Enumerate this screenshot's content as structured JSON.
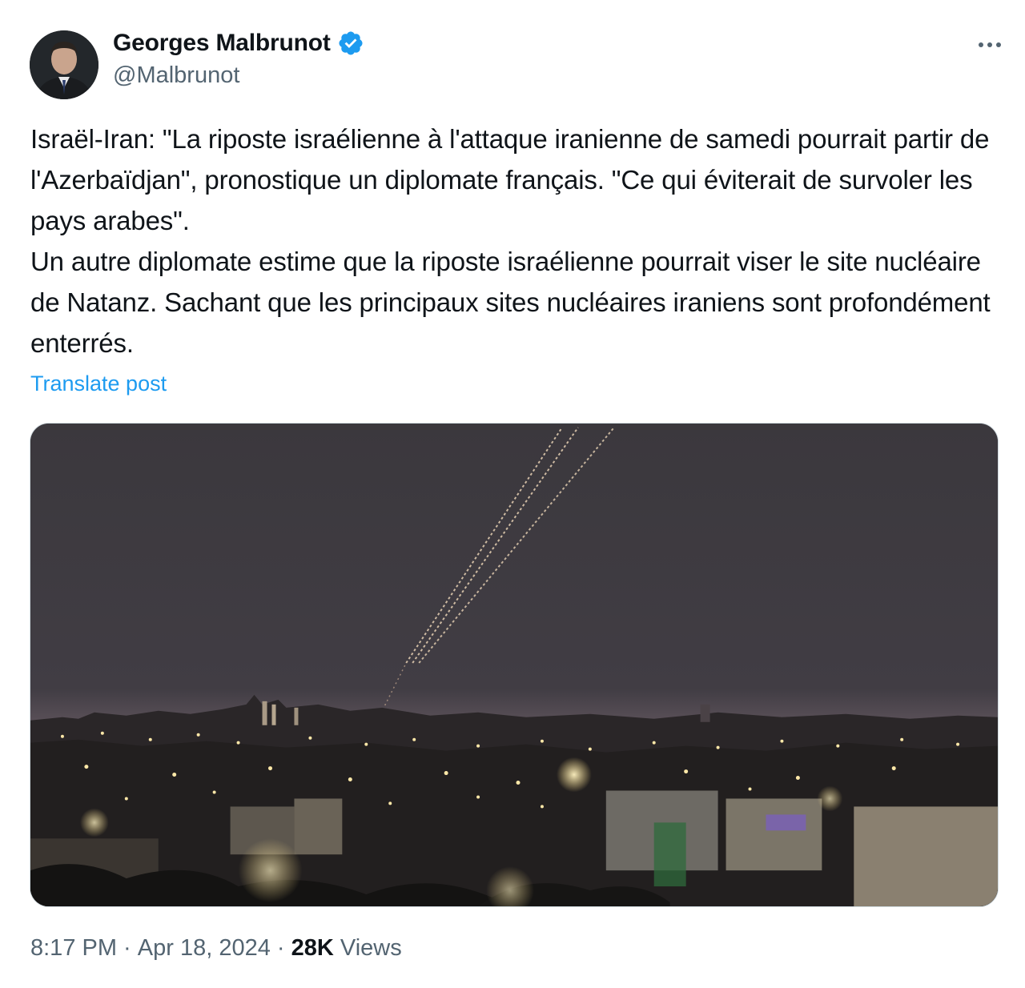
{
  "author": {
    "name": "Georges Malbrunot",
    "handle": "@Malbrunot",
    "verified": true,
    "avatar_icon": "profile-photo"
  },
  "more_icon": "more-horizontal-icon",
  "post": {
    "text": "Israël-Iran: \"La riposte israélienne à l'attaque iranienne de samedi pourrait partir de l'Azerbaïdjan\", pronostique un diplomate français. \"Ce qui éviterait de survoler les pays arabes\".\nUn autre diplomate estime que la riposte israélienne pourrait viser le site nucléaire de Natanz. Sachant que les principaux sites nucléaires iraniens sont profondément enterrés.",
    "translate_label": "Translate post"
  },
  "media": {
    "alt_icon": "night-city-interception-photo"
  },
  "meta": {
    "time": "8:17 PM",
    "separator": " · ",
    "date": "Apr 18, 2024",
    "views_count": "28K",
    "views_label": " Views"
  },
  "colors": {
    "accent": "#1d9bf0",
    "secondary_text": "#536471",
    "primary_text": "#0f1419"
  }
}
